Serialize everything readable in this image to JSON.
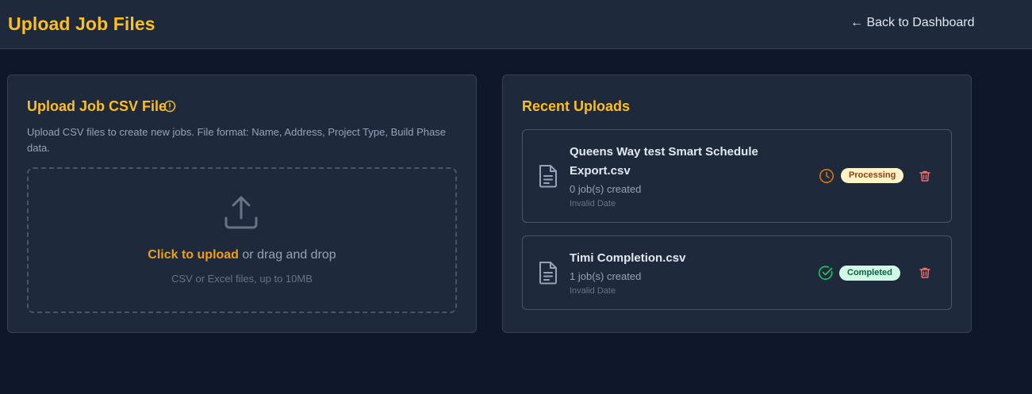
{
  "header": {
    "title": "Upload Job Files",
    "back_link": "← Back to Dashboard"
  },
  "upload_card": {
    "title": "Upload Job CSV File",
    "info_icon": "info-circle-icon",
    "description": "Upload CSV files to create new jobs. File format: Name, Address, Project Type, Build Phase data.",
    "dropzone": {
      "icon": "upload-icon",
      "link_text": "Click to upload",
      "rest_text": " or drag and drop",
      "hint": "CSV or Excel files, up to 10MB"
    }
  },
  "recent_card": {
    "title": "Recent Uploads",
    "files": [
      {
        "name": "Queens Way test Smart Schedule Export.csv",
        "jobs_created": "0 job(s) created",
        "date": "Invalid Date",
        "status": "Processing",
        "status_icon": "clock-icon",
        "status_color": "#d97706"
      },
      {
        "name": "Timi Completion.csv",
        "jobs_created": "1 job(s) created",
        "date": "Invalid Date",
        "status": "Completed",
        "status_icon": "check-circle-icon",
        "status_color": "#22c55e"
      }
    ]
  },
  "colors": {
    "accent": "#fbbf24",
    "background": "#0f172a",
    "card": "#1e293b",
    "danger": "#f87171"
  }
}
